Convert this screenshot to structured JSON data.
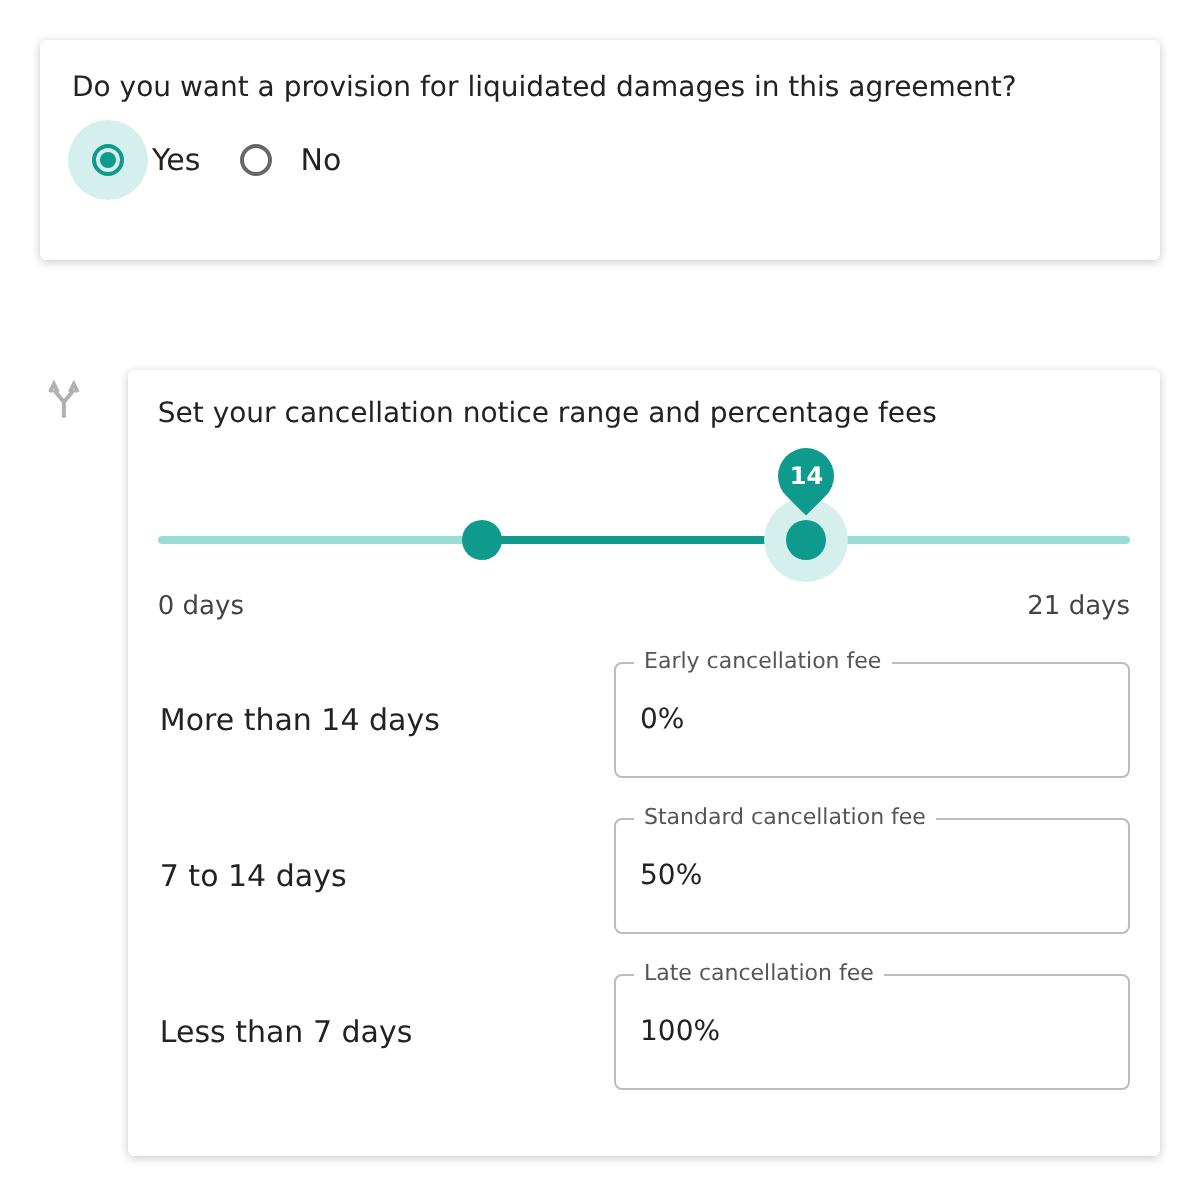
{
  "question": {
    "text": "Do you want a provision for liquidated damages in this agreement?",
    "options": [
      {
        "label": "Yes",
        "selected": true
      },
      {
        "label": "No",
        "selected": false
      }
    ]
  },
  "range_card": {
    "title": "Set your cancellation notice range and percentage fees",
    "slider": {
      "thumbs": [
        {
          "level": 0.333
        },
        {
          "level": 0.667,
          "value_label": "14"
        }
      ],
      "min_label": "0 days",
      "max_label": "21 days"
    },
    "fees": [
      {
        "period": "More than 14 days",
        "field_label": "Early cancellation fee",
        "value": "0%"
      },
      {
        "period": "7 to 14 days",
        "field_label": "Standard cancellation fee",
        "value": "50%"
      },
      {
        "period": "Less than 7 days",
        "field_label": "Late cancellation fee",
        "value": "100%"
      }
    ]
  }
}
